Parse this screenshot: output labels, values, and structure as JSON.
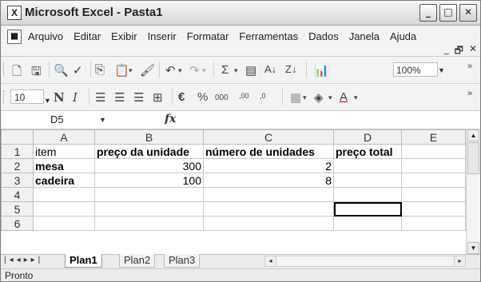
{
  "window": {
    "title": "Microsoft Excel - Pasta1",
    "app_icon": "excel-icon"
  },
  "title_buttons": {
    "minimize": "_",
    "restore": "□",
    "close": "✕"
  },
  "menu": {
    "items": [
      {
        "label": "Arquivo"
      },
      {
        "label": "Editar"
      },
      {
        "label": "Exibir"
      },
      {
        "label": "Inserir"
      },
      {
        "label": "Formatar"
      },
      {
        "label": "Ferramentas"
      },
      {
        "label": "Dados"
      },
      {
        "label": "Janela"
      },
      {
        "label": "Ajuda"
      }
    ],
    "doc_controls": {
      "minimize": "_",
      "restore": "🗗",
      "close": "✕"
    }
  },
  "toolbar_standard": {
    "zoom": "100%"
  },
  "toolbar_format": {
    "font_size": "10",
    "bold": "N",
    "italic": "I",
    "currency": "€",
    "percent": "%",
    "thousands": "000",
    "inc_decimal": ",00",
    "dec_decimal": ",0",
    "font_color_letter": "A"
  },
  "formula_bar": {
    "name_box": "D5",
    "fx": "fx",
    "content": ""
  },
  "sheet": {
    "columns": [
      "A",
      "B",
      "C",
      "D",
      "E"
    ],
    "rows": [
      {
        "num": "1",
        "cells": [
          "item",
          "preço da unidade",
          "número de unidades",
          "preço total",
          ""
        ]
      },
      {
        "num": "2",
        "cells": [
          "mesa",
          "300",
          "2",
          "",
          ""
        ]
      },
      {
        "num": "3",
        "cells": [
          "cadeira",
          "100",
          "8",
          "",
          ""
        ]
      },
      {
        "num": "4",
        "cells": [
          "",
          "",
          "",
          "",
          ""
        ]
      },
      {
        "num": "5",
        "cells": [
          "",
          "",
          "",
          "",
          ""
        ]
      },
      {
        "num": "6",
        "cells": [
          "",
          "",
          "",
          "",
          ""
        ]
      }
    ],
    "active_cell": "D5"
  },
  "tabs": [
    {
      "label": "Plan1",
      "active": true
    },
    {
      "label": "Plan2",
      "active": false
    },
    {
      "label": "Plan3",
      "active": false
    }
  ],
  "status": {
    "text": "Pronto"
  }
}
